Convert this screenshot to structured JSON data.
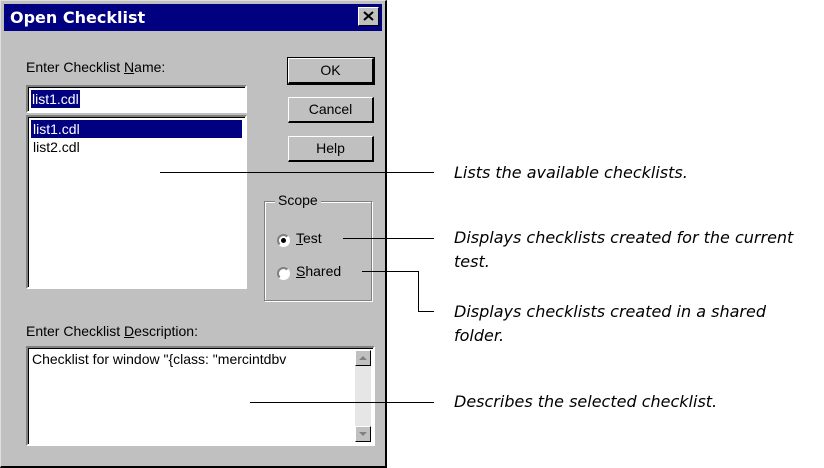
{
  "dialog": {
    "title": "Open Checklist",
    "name_label_pre": "Enter Checklist ",
    "name_label_key": "N",
    "name_label_post": "ame:",
    "name_value": "list1.cdl",
    "list_items": [
      "list1.cdl",
      "list2.cdl"
    ],
    "selected_item": "list1.cdl",
    "buttons": {
      "ok": "OK",
      "cancel": "Cancel",
      "help": "Help"
    },
    "scope": {
      "legend": "Scope",
      "test_key": "T",
      "test_rest": "est",
      "shared_key": "S",
      "shared_rest": "hared",
      "selected": "Test"
    },
    "desc_label_pre": "Enter Checklist ",
    "desc_label_key": "D",
    "desc_label_post": "escription:",
    "desc_value": "Checklist for window \"{class: \"mercintdbv"
  },
  "annotations": {
    "list": "Lists the available checklists.",
    "test_line1": "Displays checklists created for the current",
    "test_line2": "test.",
    "shared_line1": "Displays checklists created in a shared",
    "shared_line2": "folder.",
    "desc": "Describes the selected checklist."
  }
}
